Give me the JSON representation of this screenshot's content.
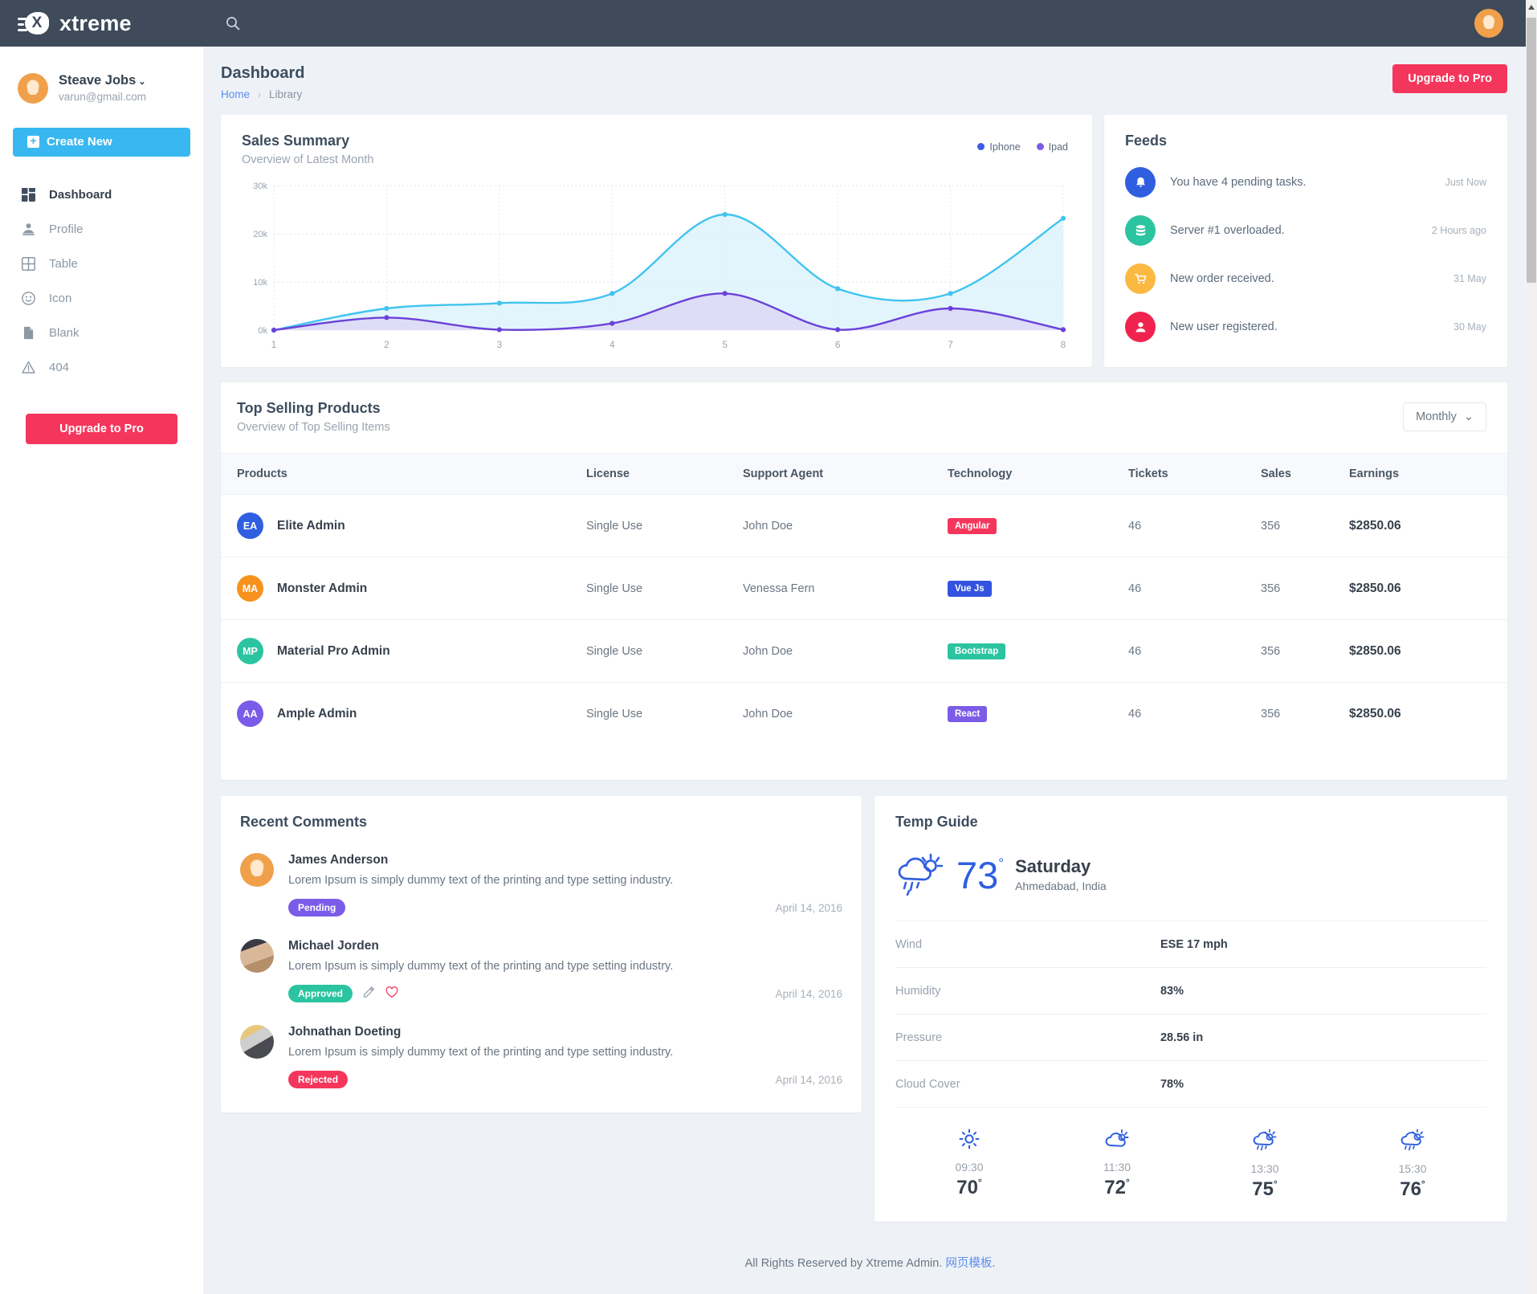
{
  "topbar": {
    "brand": "xtreme",
    "search_icon": "search-icon",
    "avatar_icon": "user-avatar"
  },
  "sidebar": {
    "profile": {
      "name": "Steave Jobs",
      "caret": "⌄",
      "email": "varun@gmail.com"
    },
    "create_new": "Create New",
    "items": [
      {
        "label": "Dashboard",
        "icon": "grid-icon",
        "active": true
      },
      {
        "label": "Profile",
        "icon": "user-icon",
        "active": false
      },
      {
        "label": "Table",
        "icon": "table-icon",
        "active": false
      },
      {
        "label": "Icon",
        "icon": "smiley-icon",
        "active": false
      },
      {
        "label": "Blank",
        "icon": "file-icon",
        "active": false
      },
      {
        "label": "404",
        "icon": "warning-icon",
        "active": false
      }
    ],
    "upgrade": "Upgrade to Pro"
  },
  "page": {
    "title": "Dashboard",
    "breadcrumb_home": "Home",
    "breadcrumb_sep": "›",
    "breadcrumb_current": "Library",
    "upgrade_button": "Upgrade to Pro"
  },
  "sales": {
    "title": "Sales Summary",
    "subtitle": "Overview of Latest Month"
  },
  "chart_data": {
    "type": "area",
    "title": "Sales Summary",
    "subtitle": "Overview of Latest Month",
    "x": [
      1,
      2,
      3,
      4,
      5,
      6,
      7,
      8
    ],
    "xlabel": "",
    "ylabel": "",
    "ylim": [
      0,
      30000
    ],
    "yticks": [
      0,
      10000,
      20000,
      30000
    ],
    "ytick_labels": [
      "0k",
      "10k",
      "20k",
      "30k"
    ],
    "xtick_labels": [
      "1",
      "2",
      "3",
      "4",
      "5",
      "6",
      "7",
      "8"
    ],
    "grid": true,
    "legend_position": "top-right",
    "series": [
      {
        "name": "Iphone",
        "color": "#41c4f0",
        "fill": "#d9f1fb",
        "legend_dot": "#3f5ae8",
        "values": [
          0,
          4500,
          5600,
          7600,
          24000,
          8600,
          7600,
          23200
        ]
      },
      {
        "name": "Ipad",
        "color": "#6b42d9",
        "fill": "#ddd8f6",
        "legend_dot": "#7b5ce8",
        "values": [
          0,
          2600,
          100,
          1400,
          7600,
          100,
          4500,
          100
        ]
      }
    ]
  },
  "feeds": {
    "title": "Feeds",
    "items": [
      {
        "text": "You have 4 pending tasks.",
        "time": "Just Now",
        "color": "#2f5fe0",
        "icon": "bell-icon"
      },
      {
        "text": "Server #1 overloaded.",
        "time": "2 Hours ago",
        "color": "#2bc4a0",
        "icon": "database-icon"
      },
      {
        "text": "New order received.",
        "time": "31 May",
        "color": "#fbb941",
        "icon": "cart-icon"
      },
      {
        "text": "New user registered.",
        "time": "30 May",
        "color": "#f0234f",
        "icon": "user-icon"
      }
    ]
  },
  "products": {
    "title": "Top Selling Products",
    "subtitle": "Overview of Top Selling Items",
    "filter_value": "Monthly",
    "filter_caret": "⌄",
    "columns": [
      "Products",
      "License",
      "Support Agent",
      "Technology",
      "Tickets",
      "Sales",
      "Earnings"
    ],
    "rows": [
      {
        "initials": "EA",
        "avatar_color": "#2f5fe0",
        "name": "Elite Admin",
        "license": "Single Use",
        "agent": "John Doe",
        "tech": "Angular",
        "tech_color": "#f5365c",
        "tickets": "46",
        "sales": "356",
        "earnings": "$2850.06"
      },
      {
        "initials": "MA",
        "avatar_color": "#f7921e",
        "name": "Monster Admin",
        "license": "Single Use",
        "agent": "Venessa Fern",
        "tech": "Vue Js",
        "tech_color": "#3352e1",
        "tickets": "46",
        "sales": "356",
        "earnings": "$2850.06"
      },
      {
        "initials": "MP",
        "avatar_color": "#2bc4a0",
        "name": "Material Pro Admin",
        "license": "Single Use",
        "agent": "John Doe",
        "tech": "Bootstrap",
        "tech_color": "#2bc4a0",
        "tickets": "46",
        "sales": "356",
        "earnings": "$2850.06"
      },
      {
        "initials": "AA",
        "avatar_color": "#7b5ce8",
        "name": "Ample Admin",
        "license": "Single Use",
        "agent": "John Doe",
        "tech": "React",
        "tech_color": "#7b5ce8",
        "tickets": "46",
        "sales": "356",
        "earnings": "$2850.06"
      }
    ]
  },
  "comments": {
    "title": "Recent Comments",
    "items": [
      {
        "name": "James Anderson",
        "text": "Lorem Ipsum is simply dummy text of the printing and type setting industry.",
        "status": "Pending",
        "status_color": "#7b5ce8",
        "date": "April 14, 2016",
        "has_actions": false,
        "avatar_kind": "placeholder-avatar"
      },
      {
        "name": "Michael Jorden",
        "text": "Lorem Ipsum is simply dummy text of the printing and type setting industry.",
        "status": "Approved",
        "status_color": "#2bc4a0",
        "date": "April 14, 2016",
        "has_actions": true,
        "avatar_kind": "photo-avatar-woman"
      },
      {
        "name": "Johnathan Doeting",
        "text": "Lorem Ipsum is simply dummy text of the printing and type setting industry.",
        "status": "Rejected",
        "status_color": "#f5365c",
        "date": "April 14, 2016",
        "has_actions": false,
        "avatar_kind": "photo-avatar-scarf"
      }
    ]
  },
  "weather": {
    "title": "Temp Guide",
    "temp": "73",
    "degree": "°",
    "day": "Saturday",
    "location": "Ahmedabad, India",
    "details": [
      {
        "key": "Wind",
        "value": "ESE 17 mph"
      },
      {
        "key": "Humidity",
        "value": "83%"
      },
      {
        "key": "Pressure",
        "value": "28.56 in"
      },
      {
        "key": "Cloud Cover",
        "value": "78%"
      }
    ],
    "forecast": [
      {
        "time": "09:30",
        "temp": "70",
        "icon": "sun-icon"
      },
      {
        "time": "11:30",
        "temp": "72",
        "icon": "sun-cloud-icon"
      },
      {
        "time": "13:30",
        "temp": "75",
        "icon": "rain-cloud-icon"
      },
      {
        "time": "15:30",
        "temp": "76",
        "icon": "rain-cloud-icon"
      }
    ]
  },
  "footer": {
    "text": "All Rights Reserved by Xtreme Admin. ",
    "link": "网页模板",
    "period": "."
  }
}
